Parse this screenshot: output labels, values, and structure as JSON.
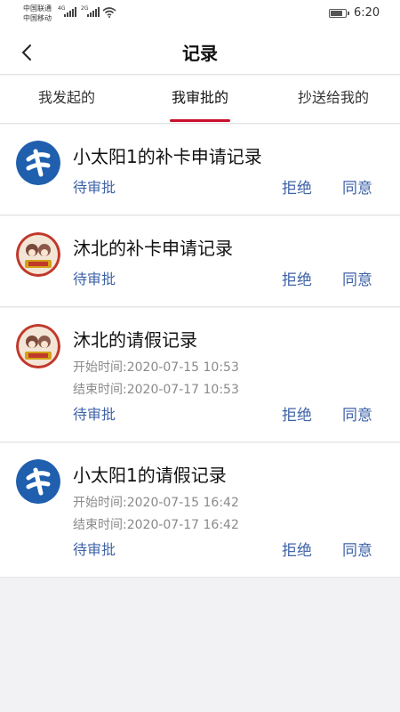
{
  "status_bar": {
    "carrier_1": "中国联通",
    "carrier_2": "中国移动",
    "net_1": "4G",
    "net_2": "2G",
    "time": "6:20",
    "battery_level": 0.85
  },
  "header": {
    "title": "记录"
  },
  "tabs": [
    {
      "label": "我发起的"
    },
    {
      "label": "我审批的"
    },
    {
      "label": "抄送给我的"
    }
  ],
  "records": [
    {
      "title": "小太阳1的补卡申请记录",
      "status": "待审批",
      "reject": "拒绝",
      "approve": "同意",
      "avatar": "logo"
    },
    {
      "title": "沐北的补卡申请记录",
      "status": "待审批",
      "reject": "拒绝",
      "approve": "同意",
      "avatar": "photo"
    },
    {
      "title": "沐北的请假记录",
      "start": "开始时间:2020-07-15 10:53",
      "end": "结束时间:2020-07-17 10:53",
      "status": "待审批",
      "reject": "拒绝",
      "approve": "同意",
      "avatar": "photo"
    },
    {
      "title": "小太阳1的请假记录",
      "start": "开始时间:2020-07-15 16:42",
      "end": "结束时间:2020-07-17 16:42",
      "status": "待审批",
      "reject": "拒绝",
      "approve": "同意",
      "avatar": "logo"
    }
  ],
  "colors": {
    "accent": "#c8102e",
    "link": "#3f63a8",
    "logo_blue": "#1f5fae"
  }
}
